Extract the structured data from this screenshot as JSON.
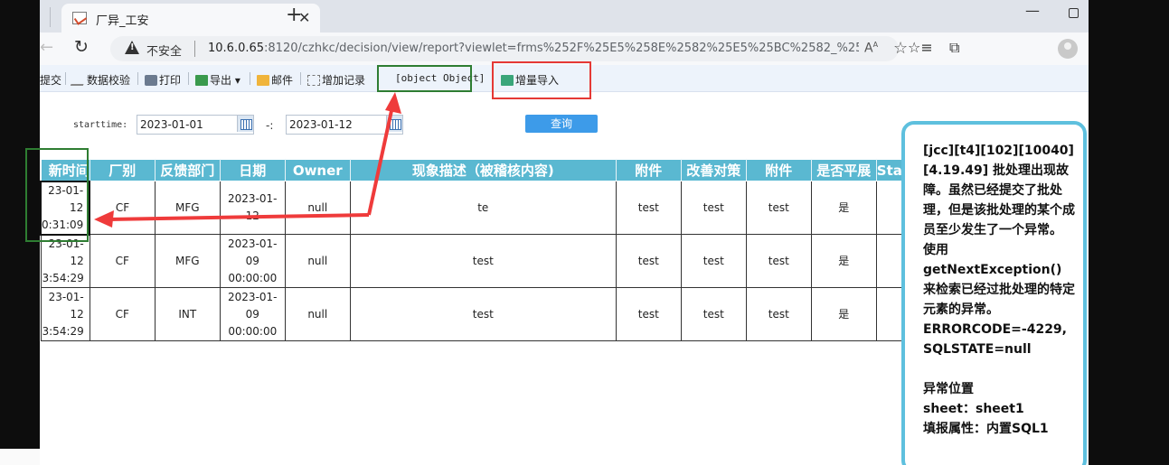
{
  "browser": {
    "tab_title": "厂异_工安",
    "close_glyph": "✕",
    "new_tab_glyph": "+",
    "minimize_glyph": "—",
    "security_text": "不安全",
    "url_host": "10.6.0.65",
    "url_rest": ":8120/czhkc/decision/view/report?viewlet=frms%252F%25E5%258E%2582%25E5%25BC%2582_%25E5%2..."
  },
  "report_toolbar": {
    "items": [
      "提交",
      "数据校验",
      "打印",
      "导出",
      "邮件",
      "增加记录",
      "[object Object]",
      "增量导入"
    ]
  },
  "filter": {
    "start_label": "starttime:",
    "start_value": "2023-01-01",
    "separator": "-:",
    "end_value": "2023-01-12",
    "query_label": "查询"
  },
  "table": {
    "headers": [
      "新时间",
      "厂别",
      "反馈部门",
      "日期",
      "Owner",
      "现象描述（被稽核内容)",
      "附件",
      "改善对策",
      "附件",
      "是否平展",
      "Sta"
    ],
    "rows": [
      {
        "c0a": "23-01-",
        "c0b": "12",
        "c0c": "0:31:09",
        "factory": "CF",
        "dept": "MFG",
        "date_a": "2023-01-",
        "date_b": "12",
        "date_c": "",
        "owner": "null",
        "desc": "te",
        "att1": "test",
        "improve": "test",
        "att2": "test",
        "flat": "是",
        "sta": ""
      },
      {
        "c0a": "23-01-",
        "c0b": "12",
        "c0c": "3:54:29",
        "factory": "CF",
        "dept": "MFG",
        "date_a": "2023-01-",
        "date_b": "09",
        "date_c": "00:00:00",
        "owner": "null",
        "desc": "test",
        "att1": "test",
        "improve": "test",
        "att2": "test",
        "flat": "是",
        "sta": ""
      },
      {
        "c0a": "23-01-",
        "c0b": "12",
        "c0c": "3:54:29",
        "factory": "CF",
        "dept": "INT",
        "date_a": "2023-01-",
        "date_b": "09",
        "date_c": "00:00:00",
        "owner": "null",
        "desc": "test",
        "att1": "test",
        "improve": "test",
        "att2": "test",
        "flat": "是",
        "sta": ""
      }
    ]
  },
  "error_popup": {
    "lines": [
      "[jcc][t4][102][10040][4.19.49] 批处理出现故障。虽然已经提交了批处理，但是该批处理的某个成员至少发生了一个异常。",
      "使用",
      "getNextException()",
      "来检索已经过批处理的特定元素的异常。",
      "ERRORCODE=-4229,",
      "SQLSTATE=null",
      "",
      "异常位置",
      "sheet：sheet1",
      "填报属性：内置SQL1"
    ]
  },
  "annotation_colors": {
    "green_box": "#2e7d32",
    "red_box": "#e53935",
    "arrow": "#ef3b3b"
  }
}
